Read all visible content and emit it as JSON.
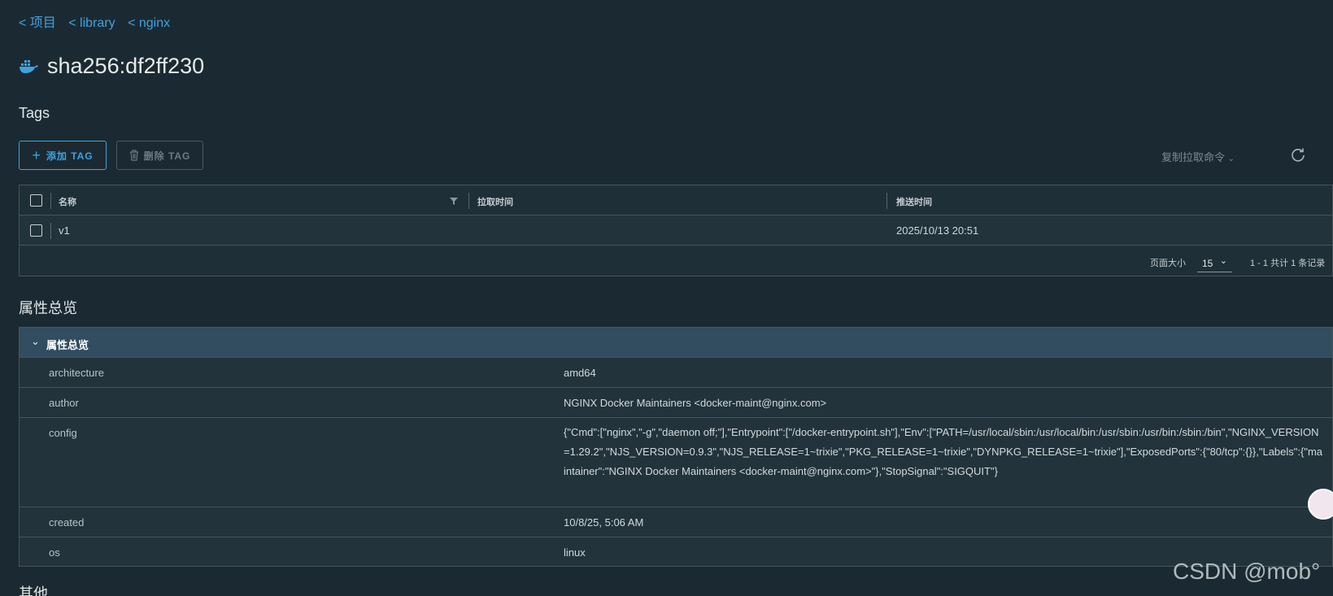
{
  "breadcrumbs": [
    "< 项目",
    "< library",
    "< nginx"
  ],
  "page": {
    "title": "sha256:df2ff230",
    "icon": "docker-whale-icon"
  },
  "tags": {
    "heading": "Tags",
    "add_label": "添加 TAG",
    "delete_label": "删除 TAG",
    "copy_cmd_label": "复制拉取命令",
    "columns": [
      "名称",
      "拉取时间",
      "推送时间"
    ],
    "rows": [
      {
        "name": "v1",
        "pull_time": "",
        "push_time": "2025/10/13 20:51"
      }
    ],
    "footer": {
      "page_size_label": "页面大小",
      "page_size": "15",
      "summary": "1 - 1 共计 1 条记录"
    }
  },
  "overview": {
    "heading": "属性总览",
    "panel_label": "属性总览",
    "props": [
      {
        "key": "architecture",
        "value": "amd64"
      },
      {
        "key": "author",
        "value": "NGINX Docker Maintainers <docker-maint@nginx.com>"
      },
      {
        "key": "config",
        "value": "{\"Cmd\":[\"nginx\",\"-g\",\"daemon off;\"],\"Entrypoint\":[\"/docker-entrypoint.sh\"],\"Env\":[\"PATH=/usr/local/sbin:/usr/local/bin:/usr/sbin:/usr/bin:/sbin:/bin\",\"NGINX_VERSION=1.29.2\",\"NJS_VERSION=0.9.3\",\"NJS_RELEASE=1~trixie\",\"PKG_RELEASE=1~trixie\",\"DYNPKG_RELEASE=1~trixie\"],\"ExposedPorts\":{\"80/tcp\":{}},\"Labels\":{\"maintainer\":\"NGINX Docker Maintainers <docker-maint@nginx.com>\"},\"StopSignal\":\"SIGQUIT\"}"
      },
      {
        "key": "created",
        "value": "10/8/25, 5:06 AM"
      },
      {
        "key": "os",
        "value": "linux"
      }
    ]
  },
  "other_heading": "其他",
  "watermark": "CSDN @mob°",
  "colors": {
    "accent": "#3fa2e0",
    "background": "#1b2a32",
    "panel_header": "#314d5f"
  }
}
